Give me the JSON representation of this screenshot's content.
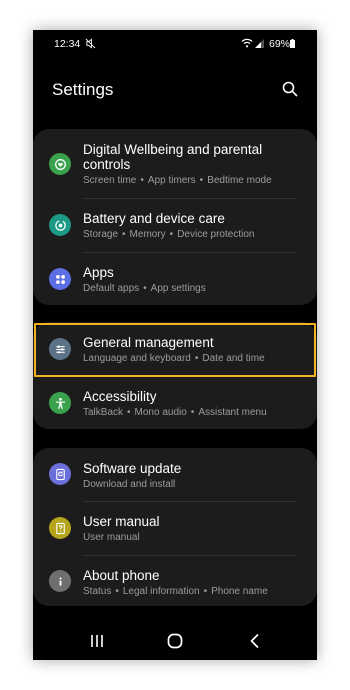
{
  "status": {
    "time": "12:34",
    "battery": "69%"
  },
  "header": {
    "title": "Settings"
  },
  "groups": [
    {
      "items": [
        {
          "title": "Digital Wellbeing and parental controls",
          "sub": [
            "Screen time",
            "App timers",
            "Bedtime mode"
          ],
          "icon": "digital-wellbeing-icon",
          "color": "#3aa14c"
        },
        {
          "title": "Battery and device care",
          "sub": [
            "Storage",
            "Memory",
            "Device protection"
          ],
          "icon": "device-care-icon",
          "color": "#1d9a86"
        },
        {
          "title": "Apps",
          "sub": [
            "Default apps",
            "App settings"
          ],
          "icon": "apps-icon",
          "color": "#5b6fe4"
        }
      ]
    },
    {
      "items": [
        {
          "title": "General management",
          "sub": [
            "Language and keyboard",
            "Date and time"
          ],
          "icon": "general-management-icon",
          "color": "#5c7287"
        },
        {
          "title": "Accessibility",
          "sub": [
            "TalkBack",
            "Mono audio",
            "Assistant menu"
          ],
          "icon": "accessibility-icon",
          "color": "#3aa14c"
        }
      ]
    },
    {
      "items": [
        {
          "title": "Software update",
          "sub": [
            "Download and install"
          ],
          "icon": "software-update-icon",
          "color": "#6b6fdc"
        },
        {
          "title": "User manual",
          "sub": [
            "User manual"
          ],
          "icon": "user-manual-icon",
          "color": "#b5a51c"
        },
        {
          "title": "About phone",
          "sub": [
            "Status",
            "Legal information",
            "Phone name"
          ],
          "icon": "about-phone-icon",
          "color": "#6f6f6f"
        }
      ]
    }
  ],
  "highlight_color": "#f4b223"
}
